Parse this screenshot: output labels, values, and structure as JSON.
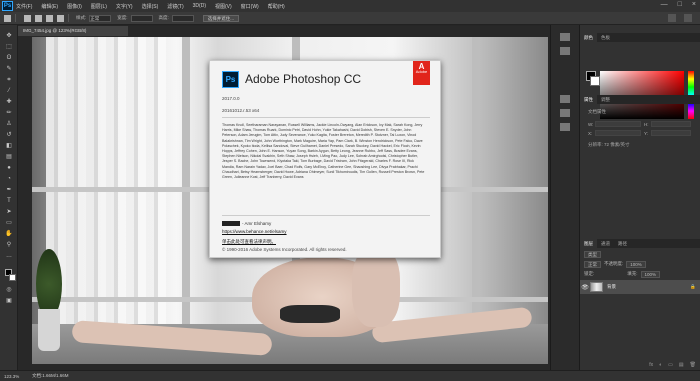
{
  "app": {
    "logo_text": "Ps",
    "menu": [
      "文件(F)",
      "编辑(E)",
      "图像(I)",
      "图层(L)",
      "文字(Y)",
      "选择(S)",
      "滤镜(T)",
      "3D(D)",
      "视图(V)",
      "窗口(W)",
      "帮助(H)"
    ],
    "window_controls": [
      "—",
      "□",
      "×"
    ]
  },
  "options_bar": {
    "mode_label": "样式:",
    "width_label": "宽度:",
    "height_label": "高度:",
    "style_value": "正常",
    "refine_button": "选择并遮住..."
  },
  "document": {
    "tab_title": "IMG_7454.jpg @ 123%(RGB/8)",
    "zoom": "123.3%",
    "doc_info": "文档:1.66M/1.66M"
  },
  "splash": {
    "logo_text": "Ps",
    "title": "Adobe Photoshop CC",
    "adobe_badge_top": "A",
    "adobe_badge_label": "Adobe",
    "version": "2017.0.0",
    "build": "20161012.r.53 x64",
    "credits": "Thomas Knoll, Seetharaman Narayanan, Russell Williams, Jackie Lincoln-Owyang, Alan Erickson, Ivy Mak, Sarah Kong, Jerry Harris, Mike Shaw, Thomas Ruark, Dominic Petri, David Hohn, Yukie Takahashi, David Dobish, Steven E. Snyder, John Peterson, Adam Jerugim, Tom Attix, Judy Severance, Yuko Kagita, Foster Brereton, Meredith P. Stotzner, Tai Luxon, Vinod Balakrishnan, Tim Wright, John Worthington, Mark Maguire, Maria Yap, Pam Clark, B. Winston Hendrickson, Pete Falco, Dave Polaschek, Kyoko Itoda, Kellisa Sandoval, Steve Guilhamet, Daniel Presedo, Sarah Stuckey, David Hackel, Eric Floch, Kevin Hopps, Jeffrey Cohen, John E. Hanson, Yuyan Song, Barkin Aygun, Betty Leong, Jeanne Rubbo, Jeff Sass, Bradee Evans, Stephen Nielson, Nikolai Svakhin, Seth Shaw, Joseph Hsieh, I-Ming Pao, Judy Lee, Sohrab Amirghodsi, Christopher Butler, Jesper S. Bache, John Townsend, Kiyotaka Taki, Tom Burbage, David Tristram, John Fitzgerald, Charles F. Rose III, Rick Mandia, Ram Narain Yadav, Joel Baer, Chad Rolfs, Gary McElroy, Catherine Gee, Shaoshing Lee, Divya Prabhakar, Prachi Chaudhari, Betsy Hearnsberger, David Howe, Adriana Ohlmeyer, Sunil Tikhomiroudis, Tim Gollen, Russell Preston Brown, Pete Green, Julieanne Kost, Jeff Tranberry, David Evans",
    "author_suffix": "- Amr Elshamy",
    "author_link": "https://www.behance.net/elsamy",
    "legal_link": "单击此处可查看法律声明。",
    "copyright": "© 1990-2016 Adobe Systems Incorporated. All rights reserved."
  },
  "panels": {
    "color_tabs": [
      "颜色",
      "色板"
    ],
    "properties_tabs": [
      "属性",
      "调整"
    ],
    "properties_title": "文档属性",
    "prop_w_label": "W:",
    "prop_w_value": "36.6 厘米",
    "prop_h_label": "H:",
    "prop_h_value": "24.4 厘米",
    "prop_x_label": "X:",
    "prop_y_label": "Y:",
    "resolution": "分辨率: 72 像素/英寸",
    "layers_tabs": [
      "图层",
      "通道",
      "路径"
    ],
    "kind_label": "类型",
    "blend_mode": "正常",
    "opacity_label": "不透明度:",
    "opacity_value": "100%",
    "lock_label": "锁定:",
    "fill_label": "填充:",
    "fill_value": "100%",
    "layer_name": "背景",
    "layer_footer_icons": [
      "fx",
      "◐",
      "▭",
      "▤",
      "🗑"
    ]
  }
}
